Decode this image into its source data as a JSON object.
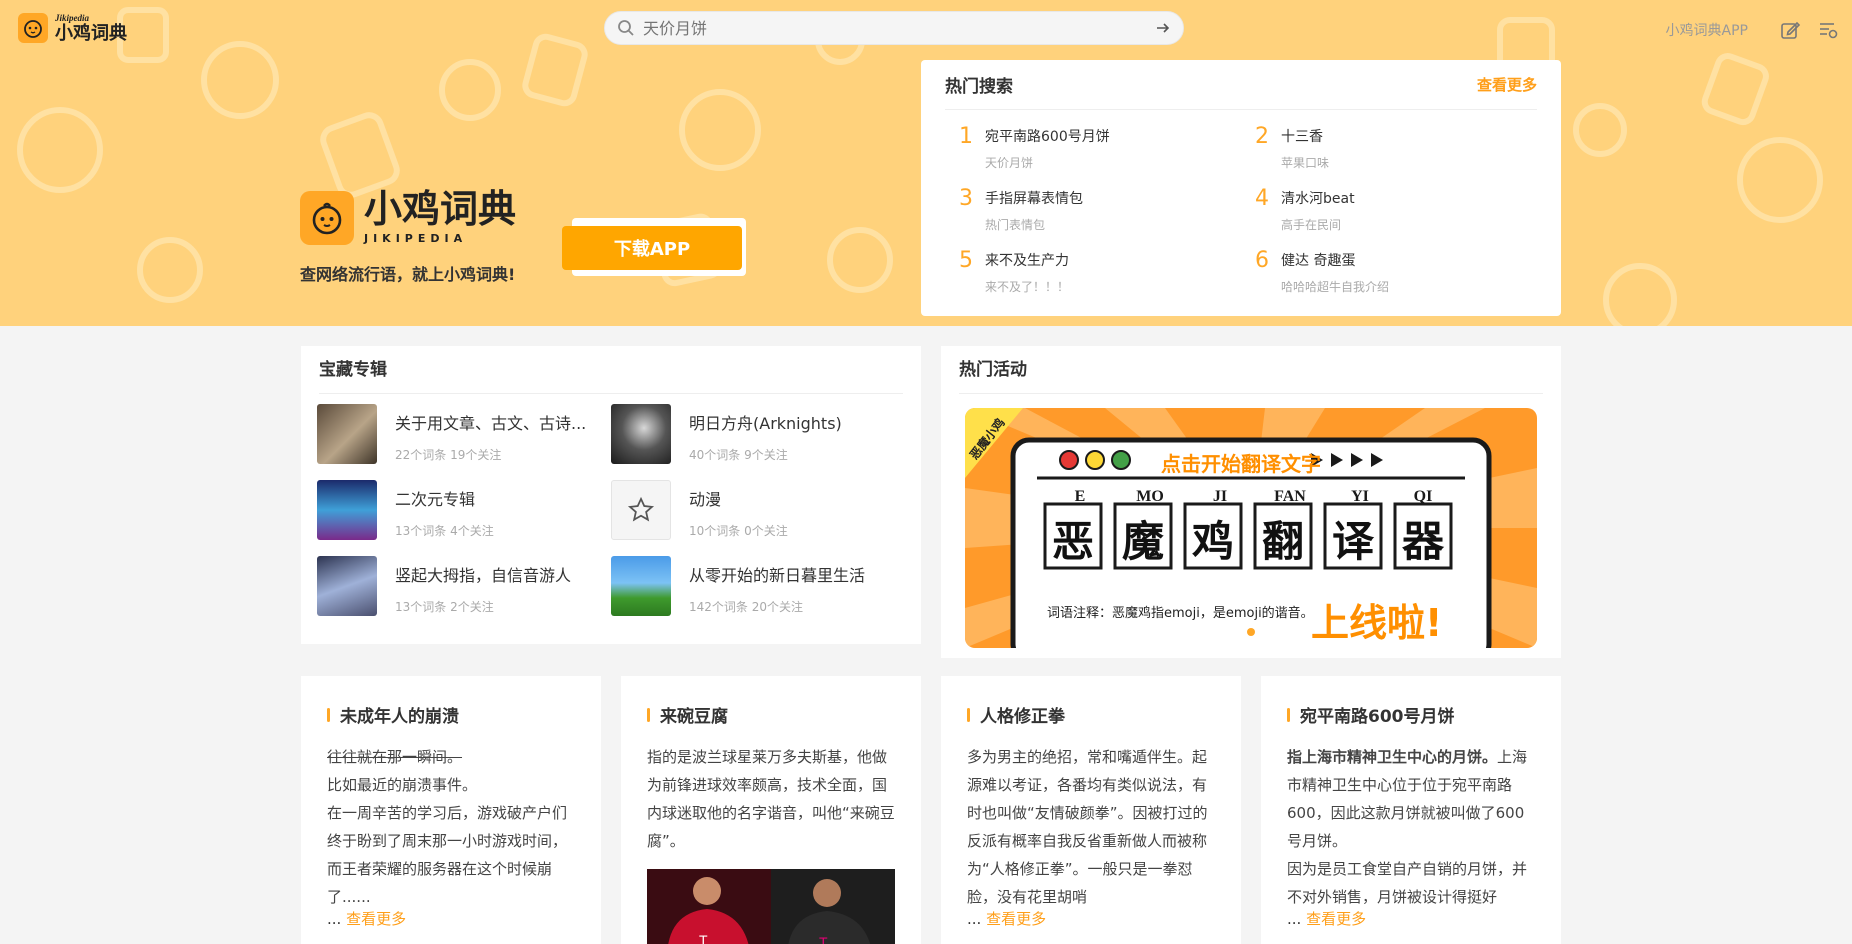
{
  "header": {
    "logo_en": "Jikipedia",
    "logo_cn": "小鸡词典",
    "search_placeholder": "天价月饼",
    "app_link": "小鸡词典APP"
  },
  "hero": {
    "brand_cn": "小鸡词典",
    "brand_en": "JIKIPEDIA",
    "slogan": "查网络流行语，就上小鸡词典!",
    "download_label": "下载APP"
  },
  "hot_search": {
    "title": "热门搜索",
    "more": "查看更多",
    "items": [
      {
        "rank": "1",
        "word": "宛平南路600号月饼",
        "sub": "天价月饼"
      },
      {
        "rank": "2",
        "word": "十三香",
        "sub": "苹果口味"
      },
      {
        "rank": "3",
        "word": "手指屏幕表情包",
        "sub": "热门表情包"
      },
      {
        "rank": "4",
        "word": "清水河beat",
        "sub": "高手在民间"
      },
      {
        "rank": "5",
        "word": "来不及生产力",
        "sub": "来不及了！！！"
      },
      {
        "rank": "6",
        "word": "健达 奇趣蛋",
        "sub": "哈哈哈超牛自我介绍"
      }
    ]
  },
  "treasure": {
    "title": "宝藏专辑",
    "items": [
      {
        "name": "关于用文章、古文、古诗...",
        "meta": "22个词条  19个关注"
      },
      {
        "name": "明日方舟(Arknights)",
        "meta": "40个词条  9个关注"
      },
      {
        "name": "二次元专辑",
        "meta": "13个词条  4个关注"
      },
      {
        "name": "动漫",
        "meta": "10个词条  0个关注"
      },
      {
        "name": "竖起大拇指，自信音游人",
        "meta": "13个词条  2个关注"
      },
      {
        "name": "从零开始的新日暮里生活",
        "meta": "142个词条  20个关注"
      }
    ]
  },
  "activity": {
    "title": "热门活动",
    "banner": {
      "corner": "恶魔小鸡",
      "click_text": "点击开始翻译文字",
      "pinyin": [
        "E",
        "MO",
        "JI",
        "FAN",
        "YI",
        "QI"
      ],
      "chars": [
        "恶",
        "魔",
        "鸡",
        "翻",
        "译",
        "器"
      ],
      "note": "词语注释：恶魔鸡指emoji，是emoji的谐音。",
      "online": "上线啦!"
    }
  },
  "words": [
    {
      "title": "未成年人的崩溃",
      "strike": "往往就在那一瞬间。",
      "body": "比如最近的崩溃事件。\n在一周辛苦的学习后，游戏破产户们终于盼到了周末那一小时游戏时间，而王者荣耀的服务器在这个时候崩了......",
      "more_prefix": "...",
      "more": "查看更多"
    },
    {
      "title": "来碗豆腐",
      "body": "指的是波兰球星莱万多夫斯基，他做为前锋进球效率颇高，技术全面，国内球迷取他的名字谐音，叫他“来碗豆腐”。",
      "more_prefix": "",
      "more": ""
    },
    {
      "title": "人格修正拳",
      "body": "多为男主的绝招，常和嘴遁伴生。起源难以考证，各番均有类似说法，有时也叫做“友情破颜拳”。因被打过的反派有概率自我反省重新做人而被称为“人格修正拳”。一般只是一拳怼脸，没有花里胡哨",
      "more_prefix": "...",
      "more": "查看更多"
    },
    {
      "title": "宛平南路600号月饼",
      "bold_lead": "指上海市精神卫生中心的月饼。",
      "body": "上海市精神卫生中心位于位于宛平南路600，因此这款月饼就被叫做了600号月饼。\n因为是员工食堂自产自销的月饼，并不对外销售，月饼被设计得挺好",
      "more_prefix": "...",
      "more": "查看更多"
    }
  ],
  "colors": {
    "accent": "#ffa726",
    "hero_bg": "#ffd27c",
    "link": "#ff9f1a"
  }
}
